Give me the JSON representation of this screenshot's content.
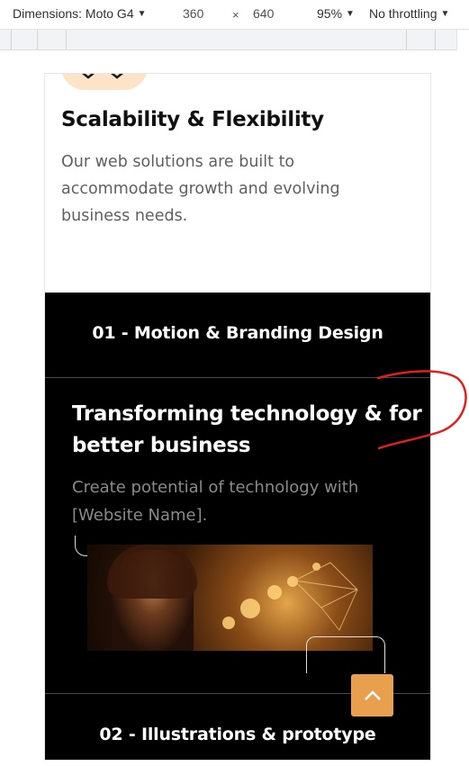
{
  "toolbar": {
    "dimensions_label": "Dimensions: Moto G4",
    "width": "360",
    "times": "×",
    "height": "640",
    "zoom": "95%",
    "throttling": "No throttling"
  },
  "card": {
    "icon": "hexagon-icon",
    "title": "Scalability & Flexibility",
    "description": "Our web solutions are built to accommodate growth and evolving business needs."
  },
  "accordion": {
    "items": [
      {
        "heading": "01 - Motion & Branding Design"
      },
      {
        "heading": "02 - Illustrations & prototype"
      }
    ],
    "panel": {
      "title": "Transforming technology & for better business",
      "description": "Create potential of technology with [Website Name]."
    }
  },
  "scroll_top": {
    "icon": "chevron-up-icon"
  },
  "colors": {
    "accent": "#e9a04e",
    "icon_bg": "#fde3c8",
    "dark_bg": "#000000",
    "annotation": "#e0201c"
  }
}
